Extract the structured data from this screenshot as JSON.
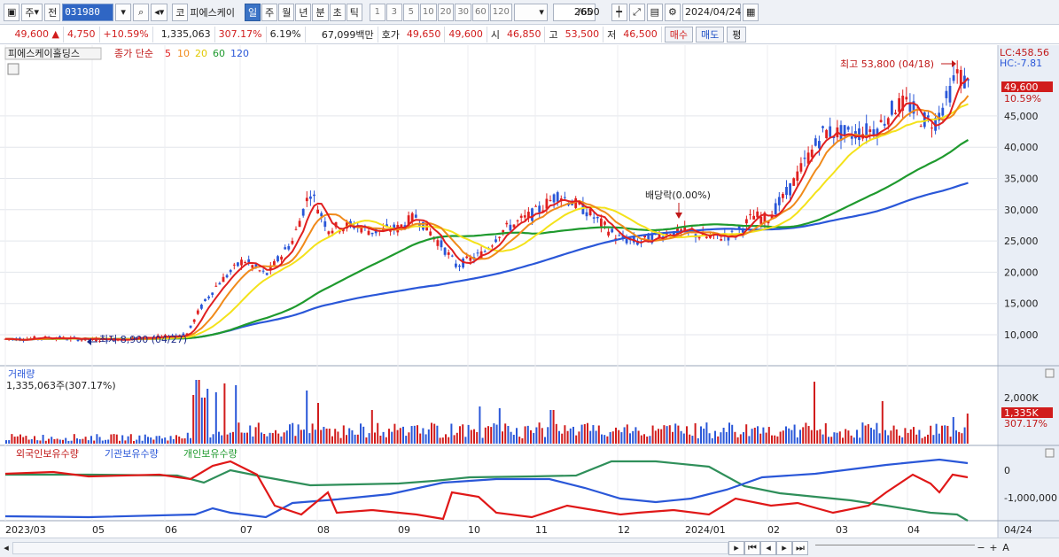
{
  "toolbar": {
    "market": "주",
    "prev": "전",
    "code": "031980",
    "name_prefix": "코",
    "name": "피에스케이",
    "periods": [
      "일",
      "주",
      "월",
      "년",
      "분",
      "초",
      "틱"
    ],
    "intervals": [
      "1",
      "3",
      "5",
      "10",
      "20",
      "30",
      "60",
      "120"
    ],
    "count": "265",
    "count_total": "/600",
    "date": "2024/04/24"
  },
  "quote": {
    "price": "49,600 ▲",
    "change": "4,750",
    "change_pct": "+10.59%",
    "volume": "1,335,063",
    "volume_ratio": "307.17%",
    "turnover_pct": "6.19%",
    "amount": "67,099백만",
    "ask_label": "호가",
    "ask1": "49,650",
    "bid1": "49,600",
    "open_label": "시",
    "open": "46,850",
    "high_label": "고",
    "high": "53,500",
    "low_label": "저",
    "low": "46,500",
    "buy": "매수",
    "sell": "매도",
    "eval": "평"
  },
  "price_panel": {
    "title": "피에스케이홀딩스",
    "ma_label": "종가 단순",
    "ma_periods": [
      "5",
      "10",
      "20",
      "60",
      "120"
    ],
    "lc": "LC:458.56",
    "hc": "HC:-7.81",
    "current_tag": "49,600",
    "current_pct": "10.59%",
    "yticks": [
      "45,000",
      "40,000",
      "35,000",
      "30,000",
      "25,000",
      "20,000",
      "15,000",
      "10,000"
    ],
    "high_annotation": "최고 53,800 (04/18)",
    "low_annotation": "최저 8,900 (04/27)",
    "dividend_annotation": "배당락(0.00%)"
  },
  "volume_panel": {
    "title": "거래량",
    "value": "1,335,063주(307.17%)",
    "ytick": "2,000K",
    "current_tag": "1,335K",
    "current_pct": "307.17%"
  },
  "holder_panel": {
    "titles": [
      "외국인보유수량",
      "기관보유수량",
      "개인보유수량"
    ],
    "yticks": [
      "0",
      "-1,000,000"
    ]
  },
  "xaxis": {
    "labels": [
      "2023/03",
      "05",
      "06",
      "07",
      "08",
      "09",
      "10",
      "11",
      "12",
      "2024/01",
      "02",
      "03",
      "04"
    ],
    "right_label": "04/24"
  },
  "colors": {
    "ma5": "#e02020",
    "ma10": "#f08a1a",
    "ma20": "#f4e21a",
    "ma60": "#1f9a2e",
    "ma120": "#2a57d8",
    "up": "#e02020",
    "down": "#2a57d8"
  }
}
